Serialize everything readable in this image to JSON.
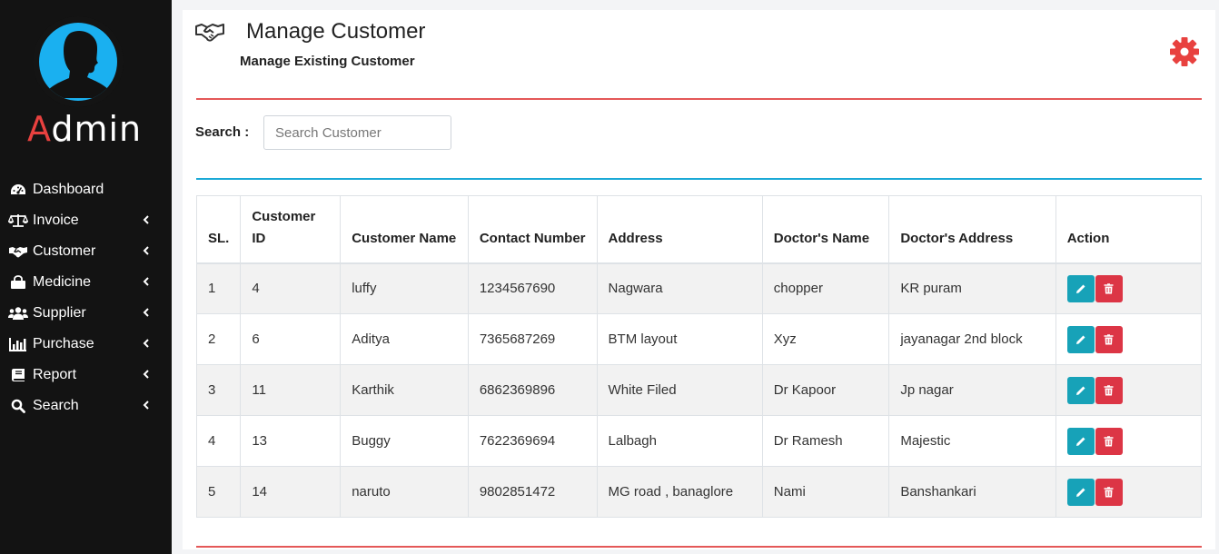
{
  "sidebar": {
    "brand_first_letter": "A",
    "brand_rest": "dmin",
    "items": [
      {
        "label": "Dashboard",
        "icon": "dashboard-icon",
        "has_submenu": false
      },
      {
        "label": "Invoice",
        "icon": "balance-scale-icon",
        "has_submenu": true
      },
      {
        "label": "Customer",
        "icon": "handshake-icon",
        "has_submenu": true
      },
      {
        "label": "Medicine",
        "icon": "shopping-bag-icon",
        "has_submenu": true
      },
      {
        "label": "Supplier",
        "icon": "users-icon",
        "has_submenu": true
      },
      {
        "label": "Purchase",
        "icon": "bar-chart-icon",
        "has_submenu": true
      },
      {
        "label": "Report",
        "icon": "book-icon",
        "has_submenu": true
      },
      {
        "label": "Search",
        "icon": "search-icon",
        "has_submenu": true
      }
    ]
  },
  "header": {
    "title": "Manage Customer",
    "subtitle": "Manage Existing Customer",
    "icon": "handshake-icon",
    "settings_icon": "gear-icon"
  },
  "search": {
    "label": "Search :",
    "placeholder": "Search Customer",
    "value": ""
  },
  "table": {
    "headers": [
      "SL.",
      "Customer ID",
      "Customer Name",
      "Contact Number",
      "Address",
      "Doctor's Name",
      "Doctor's Address",
      "Action"
    ],
    "rows": [
      [
        "1",
        "4",
        "luffy",
        "1234567690",
        "Nagwara",
        "chopper",
        "KR puram"
      ],
      [
        "2",
        "6",
        "Aditya",
        "7365687269",
        "BTM layout",
        "Xyz",
        "jayanagar 2nd block"
      ],
      [
        "3",
        "11",
        "Karthik",
        "6862369896",
        "White Filed",
        "Dr Kapoor",
        "Jp nagar"
      ],
      [
        "4",
        "13",
        "Buggy",
        "7622369694",
        "Lalbagh",
        "Dr Ramesh",
        "Majestic"
      ],
      [
        "5",
        "14",
        "naruto",
        "9802851472",
        "MG road , banaglore",
        "Nami",
        "Banshankari"
      ]
    ],
    "action_icons": [
      "pencil-icon",
      "trash-icon"
    ]
  },
  "colors": {
    "sidebar_bg": "#131313",
    "brand_accent": "#e8413f",
    "divider_red": "#e45858",
    "divider_blue": "#1aa9d6",
    "edit_button": "#17a2b8",
    "delete_button": "#dc3545",
    "gear": "#e8413f"
  }
}
